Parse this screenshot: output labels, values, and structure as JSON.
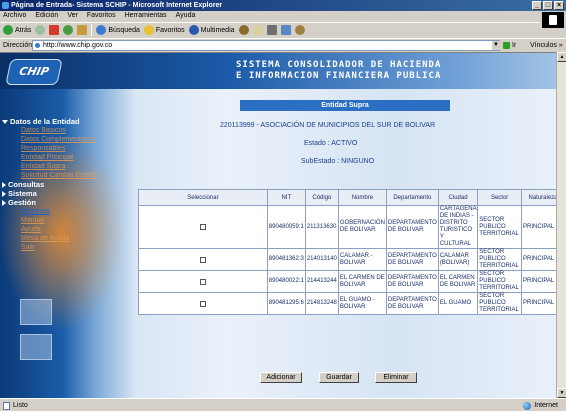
{
  "window": {
    "title": "Página de Entrada- Sistema SCHIP - Microsoft Internet Explorer",
    "min": "_",
    "max": "□",
    "close": "×"
  },
  "menu": [
    "Archivo",
    "Edición",
    "Ver",
    "Favoritos",
    "Herramientas",
    "Ayuda"
  ],
  "toolbar": {
    "back": "Atrás",
    "search": "Búsqueda",
    "favorites": "Favoritos",
    "multimedia": "Multimedia"
  },
  "address": {
    "label": "Dirección",
    "url": "http://www.chip.gov.co",
    "go": "Ir",
    "links": "Vínculos »"
  },
  "header": {
    "logo": "CHIP",
    "title_line1": "SISTEMA CONSOLIDADOR DE HACIENDA",
    "title_line2": "E INFORMACION FINANCIERA PUBLICA"
  },
  "sidebar": {
    "groups": [
      {
        "label": "Datos de la Entidad",
        "items": [
          "Datos Básicos",
          "Datos Complementarios",
          "Responsables",
          "Entidad Principal",
          "Entidad Supra",
          "Solicitud Cambio Estado"
        ]
      },
      {
        "label": "Consultas",
        "items": []
      },
      {
        "label": "Sistema",
        "items": []
      },
      {
        "label": "Gestión",
        "items": [
          "Procesos",
          "Manual",
          "Ayuda",
          "Mesa de Ayuda",
          "Salir"
        ]
      }
    ]
  },
  "main": {
    "section_title": "Entidad Supra",
    "entity_name": "220113999 - ASOCIACIÓN DE MUNICIPIOS DEL SUR DE BOLIVAR",
    "estado": "Estado : ACTIVO",
    "subestado": "SubEstado : NINGUNO",
    "columns": [
      "Seleccionar",
      "NIT",
      "Código",
      "Nombre",
      "Departamento",
      "Ciudad",
      "Sector",
      "Naturaleza"
    ],
    "rows": [
      {
        "nit": "890480059:1",
        "codigo": "211313630",
        "nombre": "GOBERNACIÓN DE BOLIVAR",
        "departamento": "DEPARTAMENTO DE BOLIVAR",
        "ciudad": "CARTAGENA DE INDIAS - DISTRITO TURISTICO Y CULTURAL",
        "sector": "SECTOR PUBLICO TERRITORIAL",
        "naturaleza": "PRINCIPAL"
      },
      {
        "nit": "890481362:3",
        "codigo": "214013140",
        "nombre": "CALAMAR - BOLIVAR",
        "departamento": "DEPARTAMENTO DE BOLIVAR",
        "ciudad": "CALAMAR (BOLIVAR)",
        "sector": "SECTOR PUBLICO TERRITORIAL",
        "naturaleza": "PRINCIPAL"
      },
      {
        "nit": "890480022:1",
        "codigo": "214413244",
        "nombre": "EL CARMEN DE BOLIVAR",
        "departamento": "DEPARTAMENTO DE BOLIVAR",
        "ciudad": "EL CARMEN DE BOLIVAR",
        "sector": "SECTOR PUBLICO TERRITORIAL",
        "naturaleza": "PRINCIPAL"
      },
      {
        "nit": "890481295:6",
        "codigo": "214813248",
        "nombre": "EL GUAMO - BOLIVAR",
        "departamento": "DEPARTAMENTO DE BOLIVAR",
        "ciudad": "EL GUAMO",
        "sector": "SECTOR PUBLICO TERRITORIAL",
        "naturaleza": "PRINCIPAL"
      }
    ],
    "buttons": {
      "add": "Adicionar",
      "save": "Guardar",
      "delete": "Eliminar"
    }
  },
  "status": {
    "left": "Listo",
    "zone": "Internet"
  }
}
